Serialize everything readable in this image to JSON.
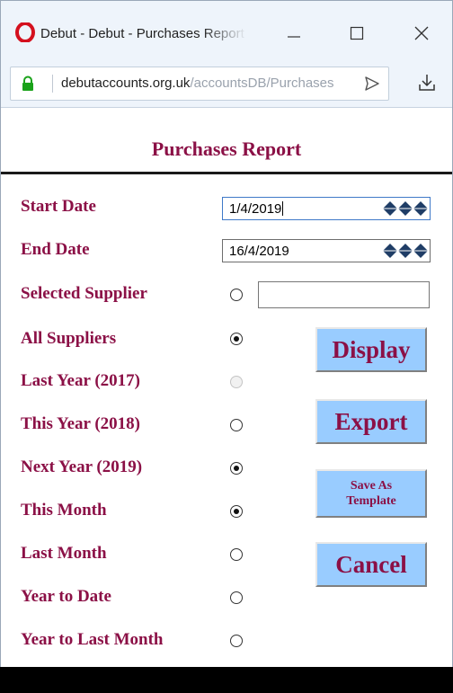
{
  "titlebar": {
    "title": "Debut - Debut - Purchases Report",
    "minimize_icon": "minimize-icon",
    "maximize_icon": "maximize-icon",
    "close_icon": "close-icon"
  },
  "addressbar": {
    "domain": "debutaccounts.org.uk",
    "path": "/accountsDB/Purchases",
    "lock_icon": "lock-icon",
    "send_icon": "send-icon",
    "download_icon": "download-icon"
  },
  "page": {
    "title": "Purchases Report"
  },
  "form": {
    "start_date_label": "Start Date",
    "start_date_value": "1/4/2019",
    "end_date_label": "End Date",
    "end_date_value": "16/4/2019",
    "selected_supplier_label": "Selected Supplier",
    "supplier_value": "",
    "options": [
      {
        "label": "All Suppliers",
        "checked": true,
        "disabled": false
      },
      {
        "label": "Last Year (2017)",
        "checked": false,
        "disabled": true
      },
      {
        "label": "This Year (2018)",
        "checked": false,
        "disabled": false
      },
      {
        "label": "Next Year (2019)",
        "checked": true,
        "disabled": false
      },
      {
        "label": "This Month",
        "checked": true,
        "disabled": false
      },
      {
        "label": "Last Month",
        "checked": false,
        "disabled": false
      },
      {
        "label": "Year to Date",
        "checked": false,
        "disabled": false
      },
      {
        "label": "Year to Last Month",
        "checked": false,
        "disabled": false
      }
    ]
  },
  "buttons": {
    "display": "Display",
    "export": "Export",
    "save_as_template_line1": "Save As",
    "save_as_template_line2": "Template",
    "cancel": "Cancel"
  },
  "colors": {
    "label": "#8b1046",
    "button_bg": "#99ccff",
    "title_bar": "#eef4fb",
    "spin_icon": "#1f3d66"
  }
}
